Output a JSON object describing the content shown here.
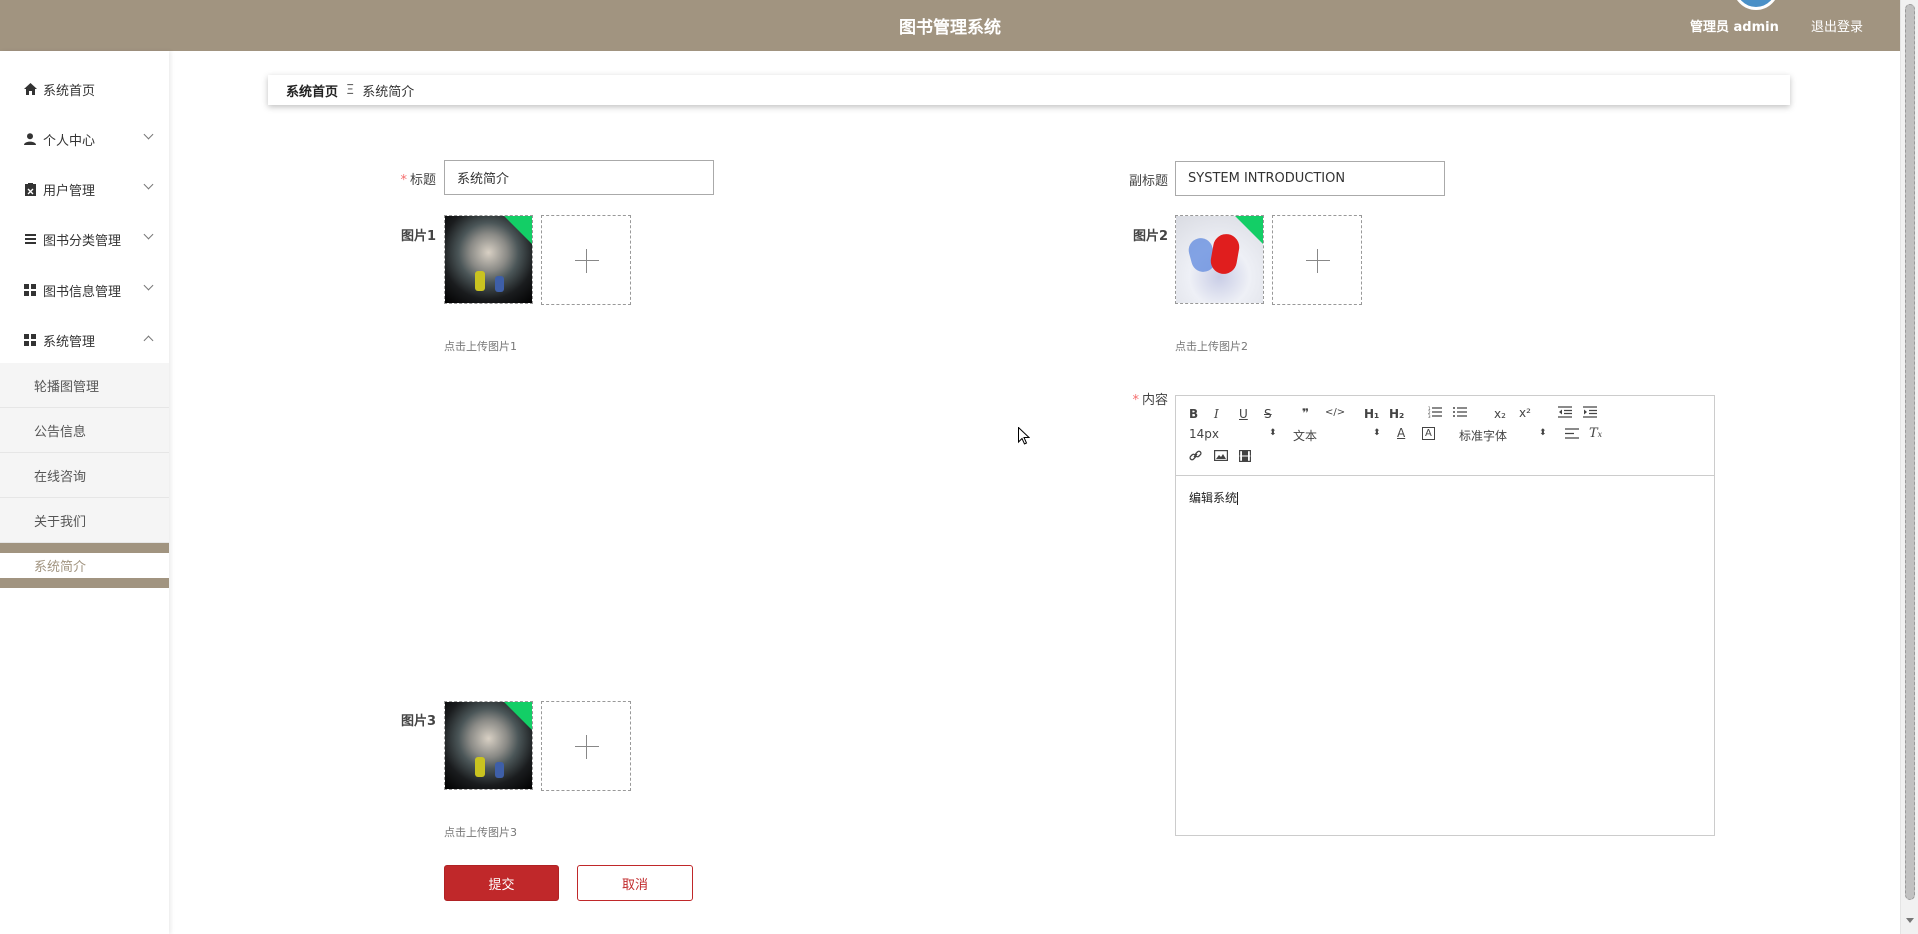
{
  "header": {
    "title": "图书管理系统",
    "user": "管理员 admin",
    "logout": "退出登录"
  },
  "sidebar": {
    "items": [
      {
        "label": "系统首页",
        "icon": "home-icon"
      },
      {
        "label": "个人中心",
        "icon": "person-icon"
      },
      {
        "label": "用户管理",
        "icon": "clipboard-icon"
      },
      {
        "label": "图书分类管理",
        "icon": "list-icon"
      },
      {
        "label": "图书信息管理",
        "icon": "grid-icon"
      },
      {
        "label": "系统管理",
        "icon": "grid-icon"
      }
    ],
    "sub_items": [
      "轮播图管理",
      "公告信息",
      "在线咨询",
      "关于我们",
      "系统简介"
    ]
  },
  "breadcrumb": {
    "home": "系统首页",
    "separator": "Ξ",
    "current": "系统简介"
  },
  "form": {
    "title_label": "标题",
    "title_value": "系统简介",
    "subtitle_label": "副标题",
    "subtitle_value": "SYSTEM INTRODUCTION",
    "pic1_label": "图片1",
    "pic1_hint": "点击上传图片1",
    "pic2_label": "图片2",
    "pic2_hint": "点击上传图片2",
    "pic3_label": "图片3",
    "pic3_hint": "点击上传图片3",
    "content_label": "内容",
    "submit": "提交",
    "cancel": "取消"
  },
  "editor": {
    "tools_row1": [
      "B",
      "I",
      "U",
      "S",
      "❞",
      "</>",
      "H₁",
      "H₂",
      "list-ordered-icon",
      "list-bullet-icon",
      "x₂",
      "x²",
      "outdent-icon",
      "indent-icon"
    ],
    "font_size": "14px",
    "paragraph": "文本",
    "font_family": "标准字体",
    "content": "编辑系统"
  },
  "colors": {
    "header": "#a19480",
    "primary": "#c0282a",
    "required": "#f56c6c",
    "badge": "#13ce66"
  }
}
